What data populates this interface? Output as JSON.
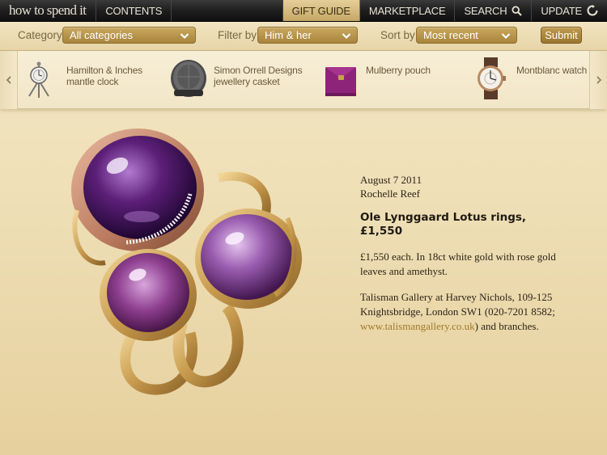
{
  "topbar": {
    "logo": "how to spend it",
    "contents": "CONTENTS",
    "gift_guide": "GIFT GUIDE",
    "marketplace": "MARKETPLACE",
    "search": "SEARCH",
    "update": "UPDATE",
    "active_tab_color": "#d6bb7c"
  },
  "filters": {
    "category_label": "Category",
    "category_value": "All categories",
    "filter_label": "Filter by",
    "filter_value": "Him & her",
    "sort_label": "Sort by",
    "sort_value": "Most recent",
    "submit_label": "Submit"
  },
  "carousel": {
    "items": [
      {
        "label_line1": "Hamilton & Inches",
        "label_line2": "mantle clock",
        "icon": "clock-thumbnail"
      },
      {
        "label_line1": "Simon Orrell Designs",
        "label_line2": "jewellery casket",
        "icon": "casket-thumbnail"
      },
      {
        "label_line1": "Mulberry pouch",
        "label_line2": "",
        "icon": "pouch-thumbnail"
      },
      {
        "label_line1": "Montblanc watch",
        "label_line2": "",
        "icon": "watch-thumbnail"
      }
    ]
  },
  "article": {
    "date": "August 7 2011",
    "author": "Rochelle Reef",
    "headline_line1": "Ole Lynggaard Lotus rings,",
    "headline_line2": "£1,550",
    "description": "£1,550 each. In 18ct white gold with rose gold leaves and amethyst.",
    "stockist_before": "Talisman Gallery at Harvey Nichols, 109-125 Knightsbridge, London SW1 (020-7201 8582; ",
    "stockist_link": "www.talismangallery.co.uk",
    "stockist_after": ") and branches.",
    "link_color": "#a07a2c"
  },
  "colors": {
    "background": "#efe0b8",
    "accent_gold": "#b8944b"
  }
}
